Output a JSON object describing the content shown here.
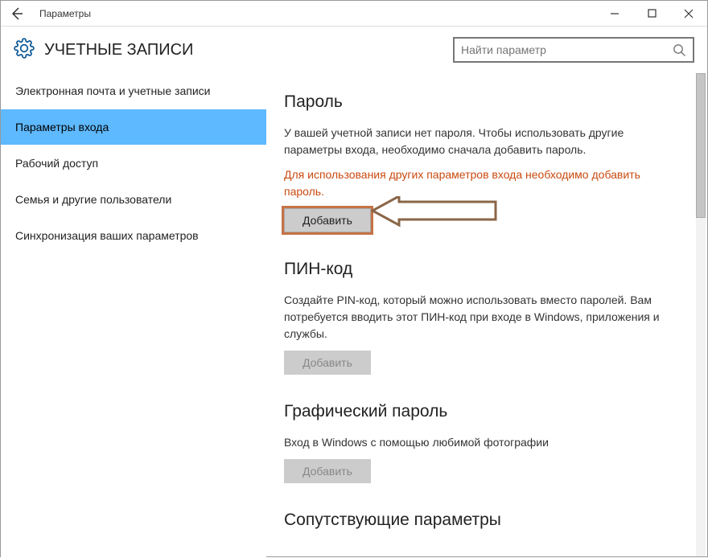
{
  "titlebar": {
    "title": "Параметры"
  },
  "header": {
    "title": "УЧЕТНЫЕ ЗАПИСИ",
    "search_placeholder": "Найти параметр"
  },
  "sidebar": {
    "items": [
      {
        "label": "Электронная почта и учетные записи",
        "active": false
      },
      {
        "label": "Параметры входа",
        "active": true
      },
      {
        "label": "Рабочий доступ",
        "active": false
      },
      {
        "label": "Семья и другие пользователи",
        "active": false
      },
      {
        "label": "Синхронизация ваших параметров",
        "active": false
      }
    ]
  },
  "sections": {
    "password": {
      "title": "Пароль",
      "desc": "У вашей учетной записи нет пароля. Чтобы использовать другие параметры входа, необходимо сначала добавить пароль.",
      "warn": "Для использования других параметров входа необходимо добавить пароль.",
      "button": "Добавить"
    },
    "pin": {
      "title": "ПИН-код",
      "desc": "Создайте PIN-код, который можно использовать вместо паролей. Вам потребуется вводить этот ПИН-код при входе в Windows, приложения и службы.",
      "button": "Добавить"
    },
    "picture": {
      "title": "Графический пароль",
      "desc": "Вход в Windows с помощью любимой фотографии",
      "button": "Добавить"
    },
    "related": {
      "title": "Сопутствующие параметры"
    }
  }
}
